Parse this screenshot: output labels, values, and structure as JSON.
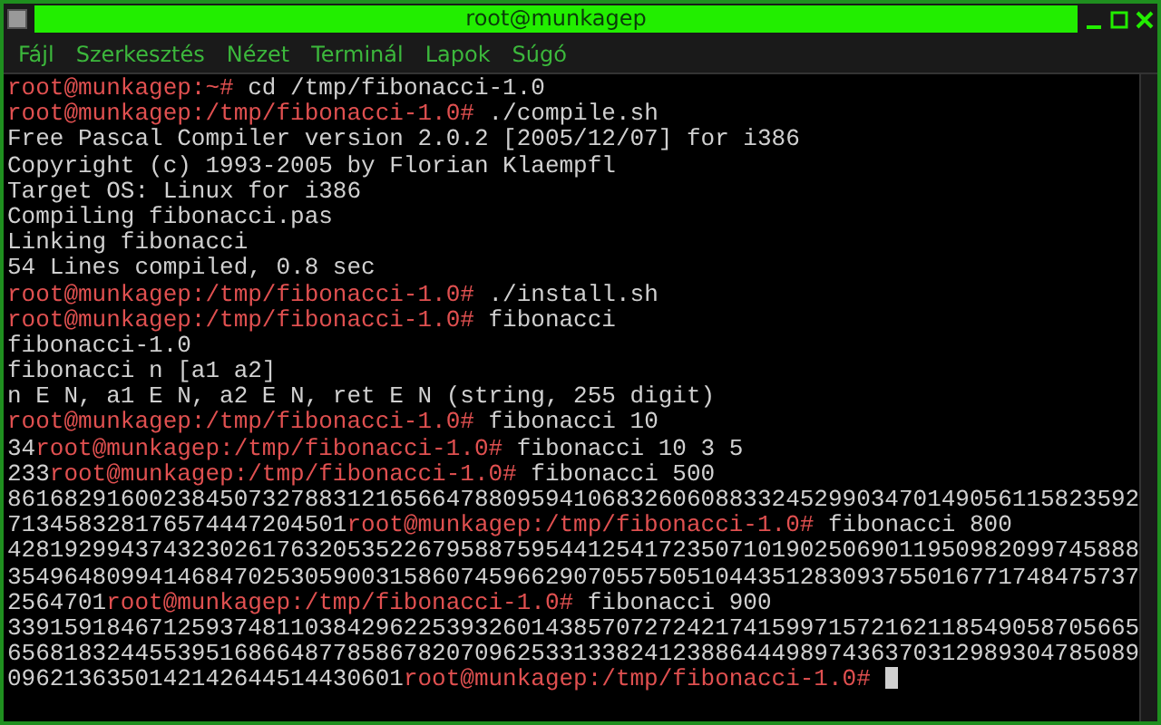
{
  "window": {
    "title": "root@munkagep"
  },
  "menu": [
    "Fájl",
    "Szerkesztés",
    "Nézet",
    "Terminál",
    "Lapok",
    "Súgó"
  ],
  "terminal": {
    "lines": [
      [
        {
          "kind": "prompt",
          "text": "root@munkagep:~#"
        },
        {
          "kind": "output",
          "text": " cd /tmp/fibonacci-1.0"
        }
      ],
      [
        {
          "kind": "prompt",
          "text": "root@munkagep:/tmp/fibonacci-1.0#"
        },
        {
          "kind": "output",
          "text": " ./compile.sh"
        }
      ],
      [
        {
          "kind": "output",
          "text": "Free Pascal Compiler version 2.0.2 [2005/12/07] for i386"
        }
      ],
      [
        {
          "kind": "output",
          "text": "Copyright (c) 1993-2005 by Florian Klaempfl"
        }
      ],
      [
        {
          "kind": "output",
          "text": "Target OS: Linux for i386"
        }
      ],
      [
        {
          "kind": "output",
          "text": "Compiling fibonacci.pas"
        }
      ],
      [
        {
          "kind": "output",
          "text": "Linking fibonacci"
        }
      ],
      [
        {
          "kind": "output",
          "text": "54 Lines compiled, 0.8 sec"
        }
      ],
      [
        {
          "kind": "prompt",
          "text": "root@munkagep:/tmp/fibonacci-1.0#"
        },
        {
          "kind": "output",
          "text": " ./install.sh"
        }
      ],
      [
        {
          "kind": "prompt",
          "text": "root@munkagep:/tmp/fibonacci-1.0#"
        },
        {
          "kind": "output",
          "text": " fibonacci"
        }
      ],
      [
        {
          "kind": "output",
          "text": "fibonacci-1.0"
        }
      ],
      [
        {
          "kind": "output",
          "text": "fibonacci n [a1 a2]"
        }
      ],
      [
        {
          "kind": "output",
          "text": "n E N, a1 E N, a2 E N, ret E N (string, 255 digit)"
        }
      ],
      [
        {
          "kind": "prompt",
          "text": "root@munkagep:/tmp/fibonacci-1.0#"
        },
        {
          "kind": "output",
          "text": " fibonacci 10"
        }
      ],
      [
        {
          "kind": "output",
          "text": "34"
        },
        {
          "kind": "prompt",
          "text": "root@munkagep:/tmp/fibonacci-1.0#"
        },
        {
          "kind": "output",
          "text": " fibonacci 10 3 5"
        }
      ],
      [
        {
          "kind": "output",
          "text": "233"
        },
        {
          "kind": "prompt",
          "text": "root@munkagep:/tmp/fibonacci-1.0#"
        },
        {
          "kind": "output",
          "text": " fibonacci 500"
        }
      ],
      [
        {
          "kind": "output",
          "text": "86168291600238450732788312165664788095941068326060883324529903470149056115823592"
        }
      ],
      [
        {
          "kind": "output",
          "text": "713458328176574447204501"
        },
        {
          "kind": "prompt",
          "text": "root@munkagep:/tmp/fibonacci-1.0#"
        },
        {
          "kind": "output",
          "text": " fibonacci 800"
        }
      ],
      [
        {
          "kind": "output",
          "text": "42819299437432302617632053522679588759544125417235071019025069011950982099745888"
        }
      ],
      [
        {
          "kind": "output",
          "text": "35496480994146847025305900315860745966290705575051044351283093755016771748475737"
        }
      ],
      [
        {
          "kind": "output",
          "text": "2564701"
        },
        {
          "kind": "prompt",
          "text": "root@munkagep:/tmp/fibonacci-1.0#"
        },
        {
          "kind": "output",
          "text": " fibonacci 900"
        }
      ],
      [
        {
          "kind": "output",
          "text": "33915918467125937481103842962253932601438570727242174159971572162118549058705665"
        }
      ],
      [
        {
          "kind": "output",
          "text": "65681832445539516866487785867820709625331338241238864449897436370312989304785089"
        }
      ],
      [
        {
          "kind": "output",
          "text": "0962136350142142644514430601"
        },
        {
          "kind": "prompt",
          "text": "root@munkagep:/tmp/fibonacci-1.0#"
        },
        {
          "kind": "cursor"
        }
      ]
    ]
  }
}
